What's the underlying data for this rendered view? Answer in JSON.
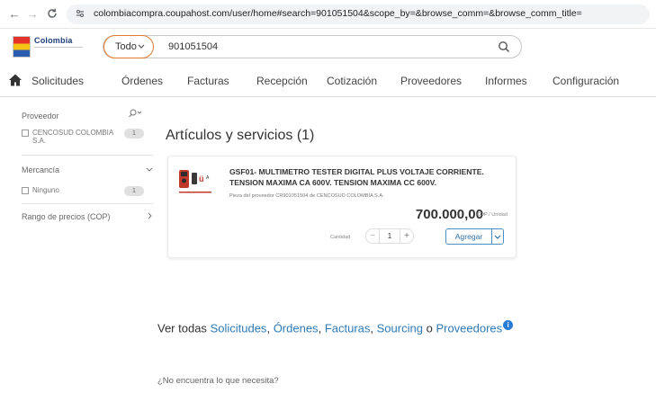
{
  "browser": {
    "back": "←",
    "forward": "→",
    "reload": "C",
    "url": "colombiacompra.coupahost.com/user/home#search=901051504&scope_by=&browse_comm=&browse_comm_title="
  },
  "header": {
    "logo_text": "Colombia",
    "search_scope": "Todo",
    "search_value": "901051504"
  },
  "nav": {
    "items": [
      "Solicitudes",
      "Órdenes",
      "Facturas",
      "Recepción",
      "Cotización",
      "Proveedores",
      "Informes",
      "Configuración"
    ]
  },
  "sidebar": {
    "supplier": {
      "title": "Proveedor",
      "option": "CENCOSUD COLOMBIA S.A.",
      "count": "1"
    },
    "commodity": {
      "title": "Mercancía",
      "option": "Ninguno",
      "count": "1"
    },
    "price": {
      "title": "Rango de precios (COP)"
    }
  },
  "results": {
    "title": "Artículos y servicios (1)"
  },
  "product": {
    "name": "GSF01- MULTIMETRO TESTER DIGITAL PLUS VOLTAJE CORRIENTE. TENSION MAXIMA CA 600V. TENSION MAXIMA CC 600V.",
    "meta": "Pieza del proveedor CR901051504 de CENCOSUD COLOMBIA S.A.",
    "price": "700.000,00",
    "unit": "COP / Unidad",
    "qty_label": "Cantidad",
    "qty_value": "1",
    "add_label": "Agregar"
  },
  "footer": {
    "prefix": "Ver todas",
    "links": [
      "Solicitudes",
      "Órdenes",
      "Facturas",
      "Sourcing"
    ],
    "or": "o",
    "last_link": "Proveedores",
    "not_found": "¿No encuentra lo que necesita?"
  },
  "colors": {
    "accent_orange": "#e07b31",
    "link_blue": "#2f7ab5",
    "button_blue": "#4a90c2"
  }
}
